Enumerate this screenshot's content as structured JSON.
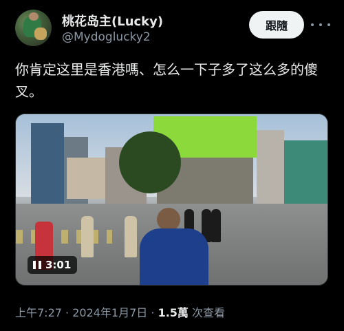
{
  "author": {
    "display_name": "桃花岛主(Lucky)",
    "handle": "@Mydoglucky2"
  },
  "follow_button": {
    "label": "跟隨"
  },
  "more_button": {
    "icon": "more-horizontal-icon"
  },
  "tweet": {
    "text": "你肯定这里是香港嗎、怎么一下子多了这么多的傻叉。"
  },
  "media": {
    "type": "video",
    "duration": "3:01",
    "play_state_icon": "pause-icon"
  },
  "meta": {
    "time": "上午7:27",
    "separator1": " · ",
    "date": "2024年1月7日",
    "separator2": " · ",
    "views_count": "1.5萬",
    "views_label": " 次查看"
  }
}
